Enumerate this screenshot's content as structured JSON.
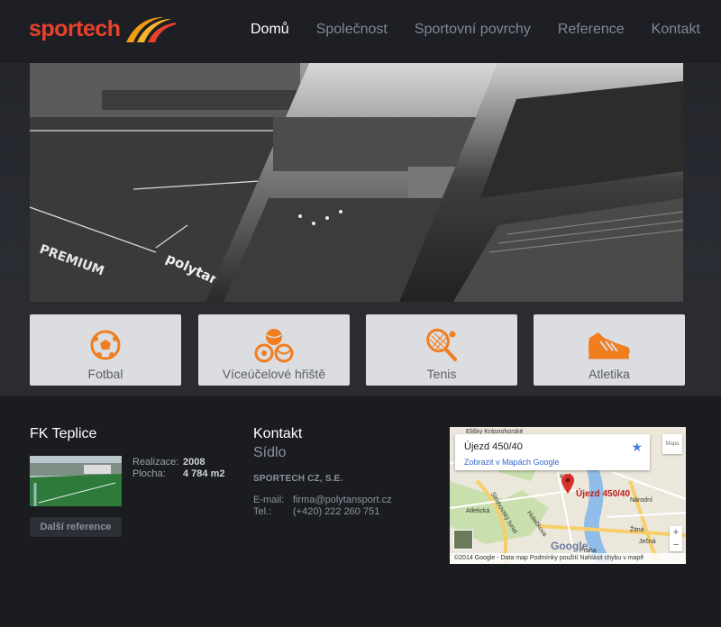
{
  "brand": {
    "name": "sportech",
    "color": "#e8412c",
    "accent": "#f39c12"
  },
  "nav": {
    "items": [
      {
        "label": "Domů",
        "active": true
      },
      {
        "label": "Společnost",
        "active": false
      },
      {
        "label": "Sportovní povrchy",
        "active": false
      },
      {
        "label": "Reference",
        "active": false
      },
      {
        "label": "Kontakt",
        "active": false
      }
    ]
  },
  "tiles": [
    {
      "label": "Fotbal",
      "icon": "soccer-ball-icon"
    },
    {
      "label": "Víceúčelové hřiště",
      "icon": "multisport-balls-icon"
    },
    {
      "label": "Tenis",
      "icon": "tennis-racket-icon"
    },
    {
      "label": "Atletika",
      "icon": "running-shoe-icon"
    }
  ],
  "tile_icon_color": "#f07d1e",
  "reference": {
    "title": "FK Teplice",
    "realizace_label": "Realizace:",
    "realizace_value": "2008",
    "plocha_label": "Plocha:",
    "plocha_value": "4 784 m2",
    "button": "Další reference"
  },
  "contact": {
    "title": "Kontakt",
    "subtitle": "Sídlo",
    "company": "SPORTECH CZ, S.E.",
    "email_label": "E-mail:",
    "email": "firma@polytansport.cz",
    "phone_label": "Tel.:",
    "phone": "(+420) 222 260 751"
  },
  "map": {
    "address": "Újezd 450/40",
    "link": "Zobrazit v Mapách Google",
    "pin_label": "Újezd 450/40",
    "logo": "Google",
    "attribution": "©2014 Google - Data map    Podmínky použití    Nahlásit chybu v mapě",
    "streets": [
      "Elišky Krásnohorské",
      "Strahovský tunel",
      "Holečkova",
      "Atletická",
      "Praha",
      "Ječná",
      "Žitná",
      "Karl",
      "Národní"
    ],
    "zoom_in": "+",
    "zoom_out": "−",
    "map_type": "Mapa"
  }
}
